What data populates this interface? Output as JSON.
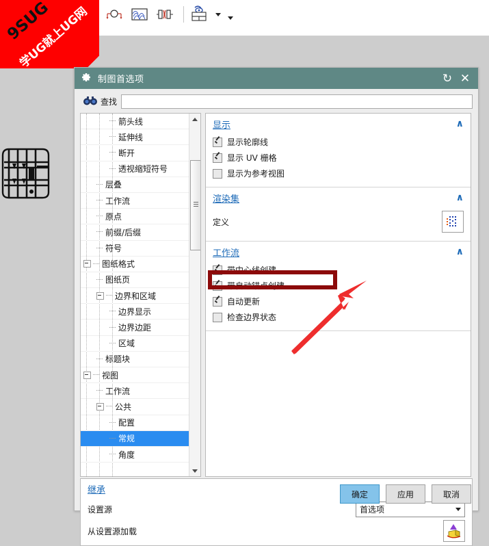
{
  "watermark": {
    "line1": "9SUG",
    "line2": "学UG就上UG网"
  },
  "toolbar": {
    "buttons": [
      {
        "name": "section-view-icon",
        "label": ""
      },
      {
        "name": "detail-view-icon",
        "label": ""
      },
      {
        "name": "break-view-icon",
        "label": ""
      },
      {
        "name": "revolved-section-icon",
        "label": ""
      },
      {
        "name": "view-table-icon",
        "label": ""
      }
    ]
  },
  "dialog": {
    "title": "制图首选项",
    "reset_icon": "↻",
    "close_icon": "✕",
    "search": {
      "label": "查找",
      "value": "",
      "placeholder": ""
    },
    "tree": [
      {
        "label": "箭头线",
        "level": 3,
        "expander": "none"
      },
      {
        "label": "延伸线",
        "level": 3,
        "expander": "none"
      },
      {
        "label": "断开",
        "level": 3,
        "expander": "none"
      },
      {
        "label": "透视缩短符号",
        "level": 3,
        "expander": "none"
      },
      {
        "label": "层叠",
        "level": 2,
        "expander": "none"
      },
      {
        "label": "工作流",
        "level": 2,
        "expander": "none"
      },
      {
        "label": "原点",
        "level": 2,
        "expander": "none"
      },
      {
        "label": "前缀/后缀",
        "level": 2,
        "expander": "none"
      },
      {
        "label": "符号",
        "level": 2,
        "expander": "none"
      },
      {
        "label": "图纸格式",
        "level": 1,
        "expander": "minus"
      },
      {
        "label": "图纸页",
        "level": 2,
        "expander": "none"
      },
      {
        "label": "边界和区域",
        "level": 2,
        "expander": "minus"
      },
      {
        "label": "边界显示",
        "level": 3,
        "expander": "none"
      },
      {
        "label": "边界边距",
        "level": 3,
        "expander": "none"
      },
      {
        "label": "区域",
        "level": 3,
        "expander": "none"
      },
      {
        "label": "标题块",
        "level": 2,
        "expander": "none"
      },
      {
        "label": "视图",
        "level": 1,
        "expander": "minus"
      },
      {
        "label": "工作流",
        "level": 2,
        "expander": "none"
      },
      {
        "label": "公共",
        "level": 2,
        "expander": "minus"
      },
      {
        "label": "配置",
        "level": 3,
        "expander": "none"
      },
      {
        "label": "常规",
        "level": 3,
        "expander": "none",
        "selected": true
      },
      {
        "label": "角度",
        "level": 3,
        "expander": "none"
      }
    ],
    "groups": [
      {
        "title": "显示",
        "collapse_icon": "∧",
        "checkboxes": [
          {
            "label": "显示轮廓线",
            "checked": true
          },
          {
            "label": "显示 UV 栅格",
            "checked": true
          },
          {
            "label": "显示为参考视图",
            "checked": false
          }
        ]
      },
      {
        "title": "渲染集",
        "collapse_icon": "∧",
        "rows": [
          {
            "label": "定义",
            "icon": "render-set-icon"
          }
        ]
      },
      {
        "title": "工作流",
        "collapse_icon": "∧",
        "checkboxes": [
          {
            "label": "带中心线创建",
            "checked": true
          },
          {
            "label": "带自动锚点创建",
            "checked": true,
            "highlighted": true
          },
          {
            "label": "自动更新",
            "checked": true
          },
          {
            "label": "检查边界状态",
            "checked": false
          }
        ]
      }
    ],
    "inherit": {
      "title": "继承",
      "collapse_icon": "∧",
      "source_label": "设置源",
      "source_value": "首选项",
      "load_label": "从设置源加载",
      "load_icon": "load-from-source-icon"
    },
    "buttons": {
      "ok": "确定",
      "apply": "应用",
      "cancel": "取消"
    }
  },
  "colors": {
    "titlebar": "#5f8885",
    "group_title": "#1e6bb8",
    "selection": "#2a8cf0",
    "highlight_box": "#8c0a0a",
    "arrow": "#ee2d2d",
    "watermark": "#fe0000",
    "primary_button": "#84c3ea"
  }
}
